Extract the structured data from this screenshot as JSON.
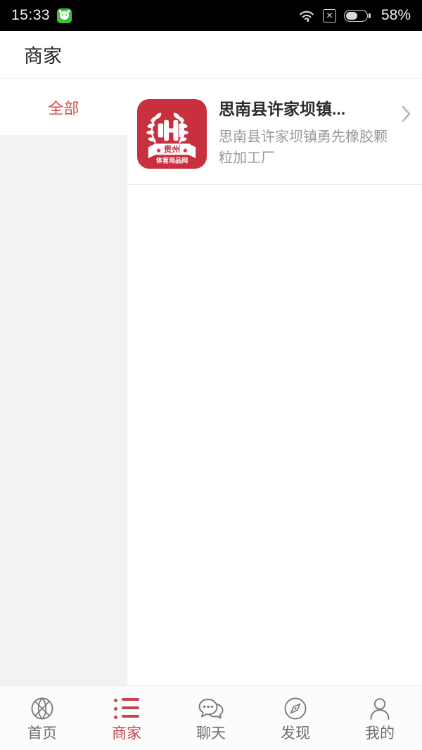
{
  "status_bar": {
    "time": "15:33",
    "app_icon": "android-robot-icon",
    "wifi_icon": "wifi-icon",
    "no_sim_icon": "no-sim-icon",
    "battery_icon": "battery-icon",
    "battery_percent": "58%",
    "battery_level": 58
  },
  "header": {
    "title": "商家"
  },
  "sidebar": {
    "items": [
      {
        "label": "全部",
        "active": true
      }
    ]
  },
  "merchant_list": {
    "items": [
      {
        "title": "思南县许家坝镇...",
        "description": "思南县许家坝镇勇先橡胶颗粒加工厂",
        "chevron": "›",
        "logo": {
          "name": "guizhou-sports-goods-logo",
          "background": "#c9303e",
          "dumbbell": "dumbbell-icon",
          "wreath": "laurel-wreath-icon",
          "ribbon_text": "贵州",
          "sub_text": "体育用品网"
        }
      }
    ]
  },
  "tabbar": {
    "items": [
      {
        "label": "首页",
        "icon": "basketball-icon",
        "active": false
      },
      {
        "label": "商家",
        "icon": "list-icon",
        "active": true
      },
      {
        "label": "聊天",
        "icon": "chat-bubbles-icon",
        "active": false
      },
      {
        "label": "发现",
        "icon": "compass-icon",
        "active": false
      },
      {
        "label": "我的",
        "icon": "person-icon",
        "active": false
      }
    ]
  },
  "colors": {
    "accent": "#c9434b",
    "logo_red": "#c9303e",
    "sidebar_bg": "#f2f2f2",
    "text_primary": "#2b2b2b",
    "text_secondary": "#9a9a9a"
  }
}
